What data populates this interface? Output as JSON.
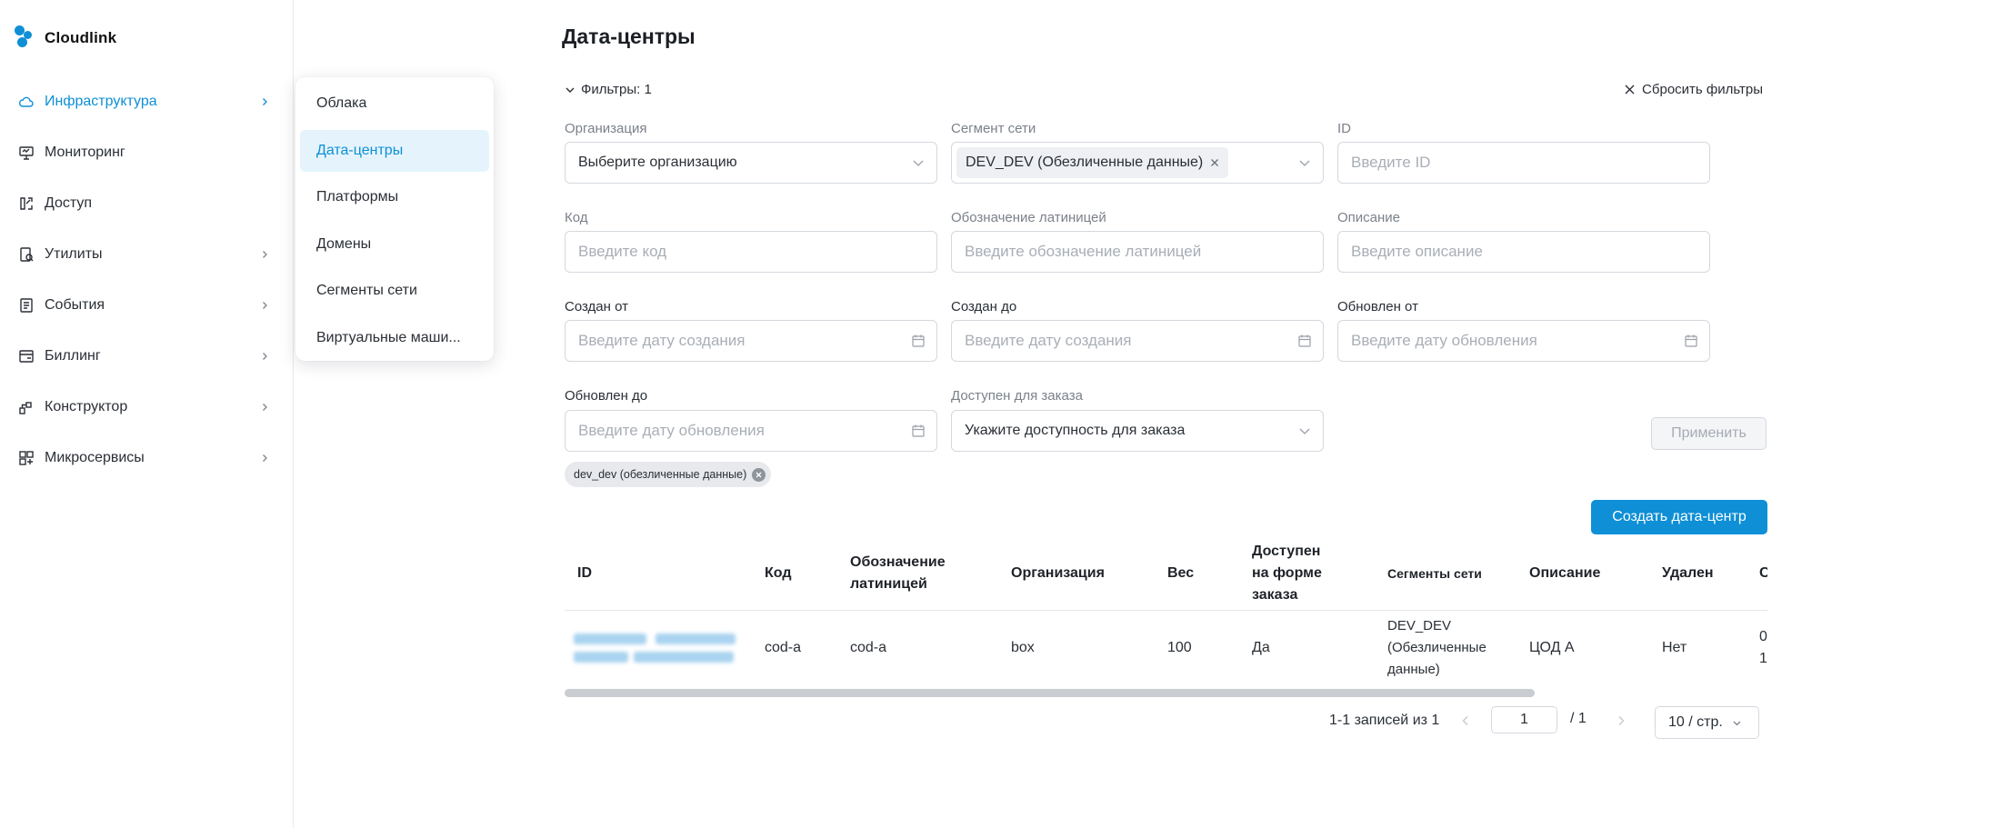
{
  "app": {
    "name": "Cloudlink"
  },
  "sidebar": {
    "items": [
      {
        "label": "Инфраструктура",
        "icon": "cloud-icon",
        "has_children": true,
        "active": true
      },
      {
        "label": "Мониторинг",
        "icon": "monitor-icon",
        "has_children": false
      },
      {
        "label": "Доступ",
        "icon": "access-icon",
        "has_children": false
      },
      {
        "label": "Утилиты",
        "icon": "utilities-icon",
        "has_children": true
      },
      {
        "label": "События",
        "icon": "events-icon",
        "has_children": true
      },
      {
        "label": "Биллинг",
        "icon": "billing-icon",
        "has_children": true
      },
      {
        "label": "Конструктор",
        "icon": "constructor-icon",
        "has_children": true
      },
      {
        "label": "Микросервисы",
        "icon": "microservices-icon",
        "has_children": true
      }
    ]
  },
  "submenu": {
    "items": [
      {
        "label": "Облака",
        "active": false
      },
      {
        "label": "Дата-центры",
        "active": true
      },
      {
        "label": "Платформы",
        "active": false
      },
      {
        "label": "Домены",
        "active": false
      },
      {
        "label": "Сегменты сети",
        "active": false
      },
      {
        "label": "Виртуальные маши...",
        "active": false
      }
    ]
  },
  "page": {
    "title": "Дата-центры"
  },
  "filters": {
    "toggle_label": "Фильтры: 1",
    "reset_label": "Сбросить фильтры",
    "organization": {
      "label": "Организация",
      "value": "Выберите организацию"
    },
    "segment": {
      "label": "Сегмент сети",
      "tag": "DEV_DEV (Обезличенные данные)"
    },
    "id": {
      "label": "ID",
      "placeholder": "Введите ID"
    },
    "code": {
      "label": "Код",
      "placeholder": "Введите код"
    },
    "latin": {
      "label": "Обозначение латиницей",
      "placeholder": "Введите обозначение латиницей"
    },
    "description": {
      "label": "Описание",
      "placeholder": "Введите описание"
    },
    "created_from": {
      "label": "Создан от",
      "placeholder": "Введите дату создания"
    },
    "created_to": {
      "label": "Создан до",
      "placeholder": "Введите дату создания"
    },
    "updated_from": {
      "label": "Обновлен от",
      "placeholder": "Введите дату обновления"
    },
    "updated_to": {
      "label": "Обновлен до",
      "placeholder": "Введите дату обновления"
    },
    "orderable": {
      "label": "Доступен для заказа",
      "value": "Укажите доступность для заказа"
    },
    "apply_label": "Применить",
    "active_chip": "dev_dev (обезличенные данные)"
  },
  "actions": {
    "create_label": "Создать дата-центр"
  },
  "table": {
    "headers": {
      "id": "ID",
      "code": "Код",
      "latin": "Обозначение латиницей",
      "org": "Организация",
      "weight": "Вес",
      "orderable": "Доступен на форме заказа",
      "segments": "Сегменты сети",
      "description": "Описание",
      "deleted": "Удален",
      "cut": "С"
    },
    "rows": [
      {
        "code": "cod-a",
        "latin": "cod-a",
        "org": "box",
        "weight": "100",
        "orderable": "Да",
        "segments": "DEV_DEV (Обезличенные данные)",
        "description": "ЦОД А",
        "deleted": "Нет",
        "cut": "0 1!"
      }
    ]
  },
  "pagination": {
    "total_text": "1-1 записей из 1",
    "current_page": "1",
    "separator": "/ 1",
    "page_size": "10 / стр."
  },
  "colors": {
    "accent": "#0e8fd6",
    "active_bg": "#e5f4fc"
  }
}
